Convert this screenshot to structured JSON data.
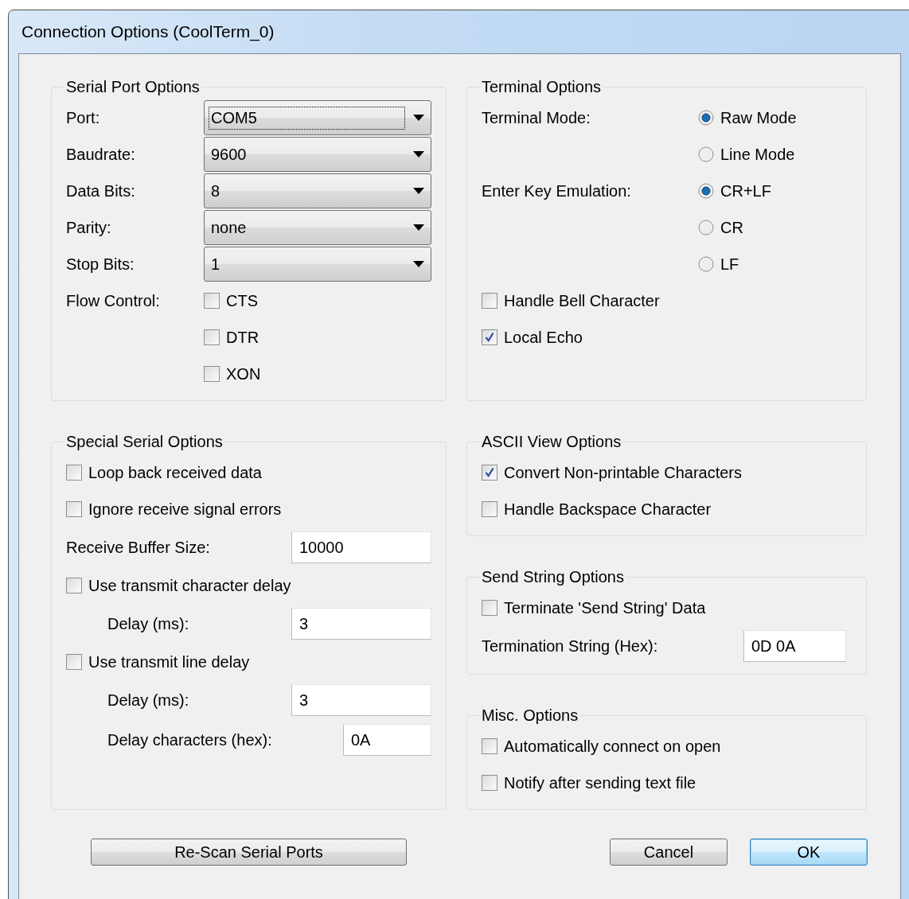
{
  "window": {
    "title": "Connection Options (CoolTerm_0)"
  },
  "serial_port_options": {
    "title": "Serial Port Options",
    "items": [
      {
        "kind": "dropdown",
        "label": "Port:",
        "value": "COM5",
        "focused": true
      },
      {
        "kind": "dropdown",
        "label": "Baudrate:",
        "value": "9600",
        "focused": false
      },
      {
        "kind": "dropdown",
        "label": "Data Bits:",
        "value": "8",
        "focused": false
      },
      {
        "kind": "dropdown",
        "label": "Parity:",
        "value": "none",
        "focused": false
      },
      {
        "kind": "dropdown",
        "label": "Stop Bits:",
        "value": "1",
        "focused": false
      },
      {
        "kind": "checkbox_group",
        "label": "Flow Control:",
        "options": [
          {
            "label": "CTS",
            "checked": false
          },
          {
            "label": "DTR",
            "checked": false
          },
          {
            "label": "XON",
            "checked": false
          }
        ]
      }
    ]
  },
  "terminal_options": {
    "title": "Terminal Options",
    "items": [
      {
        "kind": "radio_group",
        "label": "Terminal Mode:",
        "options": [
          {
            "label": "Raw Mode",
            "selected": true
          },
          {
            "label": "Line Mode",
            "selected": false
          }
        ]
      },
      {
        "kind": "radio_group",
        "label": "Enter Key Emulation:",
        "options": [
          {
            "label": "CR+LF",
            "selected": true
          },
          {
            "label": "CR",
            "selected": false
          },
          {
            "label": "LF",
            "selected": false
          }
        ]
      },
      {
        "kind": "checkbox",
        "label": "Handle Bell Character",
        "checked": false
      },
      {
        "kind": "checkbox",
        "label": "Local Echo",
        "checked": true
      }
    ]
  },
  "special_serial_options": {
    "title": "Special Serial Options",
    "items": [
      {
        "kind": "checkbox",
        "label": "Loop back received data",
        "checked": false
      },
      {
        "kind": "checkbox",
        "label": "Ignore receive signal errors",
        "checked": false
      },
      {
        "kind": "field",
        "label": "Receive Buffer Size:",
        "value": "10000"
      },
      {
        "kind": "checkbox",
        "label": "Use transmit character delay",
        "checked": false
      },
      {
        "kind": "subfield",
        "label": "Delay (ms):",
        "value": "3"
      },
      {
        "kind": "checkbox",
        "label": "Use transmit line delay",
        "checked": false
      },
      {
        "kind": "subfield",
        "label": "Delay (ms):",
        "value": "3"
      },
      {
        "kind": "short_subfield",
        "label": "Delay characters (hex):",
        "value": "0A"
      }
    ]
  },
  "ascii_view_options": {
    "title": "ASCII View Options",
    "items": [
      {
        "kind": "checkbox",
        "label": "Convert Non-printable Characters",
        "checked": true
      },
      {
        "kind": "checkbox",
        "label": "Handle Backspace Character",
        "checked": false
      }
    ]
  },
  "send_string_options": {
    "title": "Send String Options",
    "items": [
      {
        "kind": "checkbox",
        "label": "Terminate 'Send String' Data",
        "checked": false
      },
      {
        "kind": "short_field",
        "label": "Termination String (Hex):",
        "value": "0D 0A"
      }
    ]
  },
  "misc_options": {
    "title": "Misc. Options",
    "items": [
      {
        "kind": "checkbox",
        "label": "Automatically connect on open",
        "checked": false
      },
      {
        "kind": "checkbox",
        "label": "Notify after sending text file",
        "checked": false
      }
    ]
  },
  "buttons": [
    {
      "label": "Re-Scan Serial Ports",
      "default": false
    },
    {
      "label": "Cancel",
      "default": false
    },
    {
      "label": "OK",
      "default": true
    }
  ]
}
